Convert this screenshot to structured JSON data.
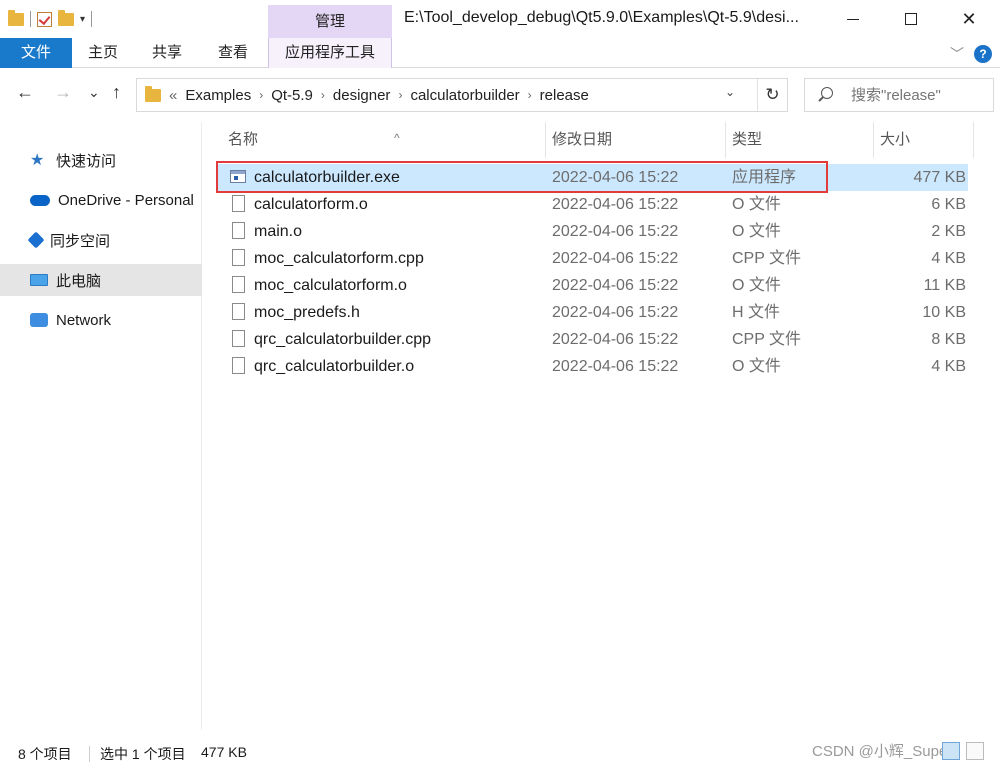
{
  "window": {
    "title": "E:\\Tool_develop_debug\\Qt5.9.0\\Examples\\Qt-5.9\\desi...",
    "manage_tab": "管理",
    "close_glyph": "✕"
  },
  "ribbon": {
    "tabs": [
      "文件",
      "主页",
      "共享",
      "查看",
      "应用程序工具"
    ],
    "expand_glyph": "﹀",
    "help_glyph": "?"
  },
  "address": {
    "back_glyph": "←",
    "forward_glyph": "→",
    "recent_glyph": "⌄",
    "up_glyph": "↑",
    "overflow": "«",
    "crumbs": [
      "Examples",
      "Qt-5.9",
      "designer",
      "calculatorbuilder",
      "release"
    ],
    "crumb_sep": "›",
    "dropdown_glyph": "⌄",
    "refresh_glyph": "↻"
  },
  "search": {
    "placeholder": "搜索\"release\""
  },
  "nav": {
    "items": [
      {
        "label": "快速访问",
        "icon": "star-icon"
      },
      {
        "label": "OneDrive - Personal",
        "icon": "cloud-icon"
      },
      {
        "label": "同步空间",
        "icon": "sync-icon"
      },
      {
        "label": "此电脑",
        "icon": "computer-icon"
      },
      {
        "label": "Network",
        "icon": "network-icon"
      }
    ]
  },
  "columns": {
    "name": "名称",
    "date": "修改日期",
    "type": "类型",
    "size": "大小",
    "sort_glyph": "^"
  },
  "files": [
    {
      "name": "calculatorbuilder.exe",
      "date": "2022-04-06 15:22",
      "type": "应用程序",
      "size": "477 KB"
    },
    {
      "name": "calculatorform.o",
      "date": "2022-04-06 15:22",
      "type": "O 文件",
      "size": "6 KB"
    },
    {
      "name": "main.o",
      "date": "2022-04-06 15:22",
      "type": "O 文件",
      "size": "2 KB"
    },
    {
      "name": "moc_calculatorform.cpp",
      "date": "2022-04-06 15:22",
      "type": "CPP 文件",
      "size": "4 KB"
    },
    {
      "name": "moc_calculatorform.o",
      "date": "2022-04-06 15:22",
      "type": "O 文件",
      "size": "11 KB"
    },
    {
      "name": "moc_predefs.h",
      "date": "2022-04-06 15:22",
      "type": "H 文件",
      "size": "10 KB"
    },
    {
      "name": "qrc_calculatorbuilder.cpp",
      "date": "2022-04-06 15:22",
      "type": "CPP 文件",
      "size": "8 KB"
    },
    {
      "name": "qrc_calculatorbuilder.o",
      "date": "2022-04-06 15:22",
      "type": "O 文件",
      "size": "4 KB"
    }
  ],
  "status": {
    "item_count": "8 个项目",
    "selection": "选中 1 个项目",
    "selection_size": "477 KB",
    "watermark": "CSDN @小辉_Super"
  },
  "colors": {
    "accent": "#1979ca",
    "selection": "#cce8ff",
    "highlight_box": "#e23b3b",
    "manage_tab": "#e4d7f5"
  }
}
